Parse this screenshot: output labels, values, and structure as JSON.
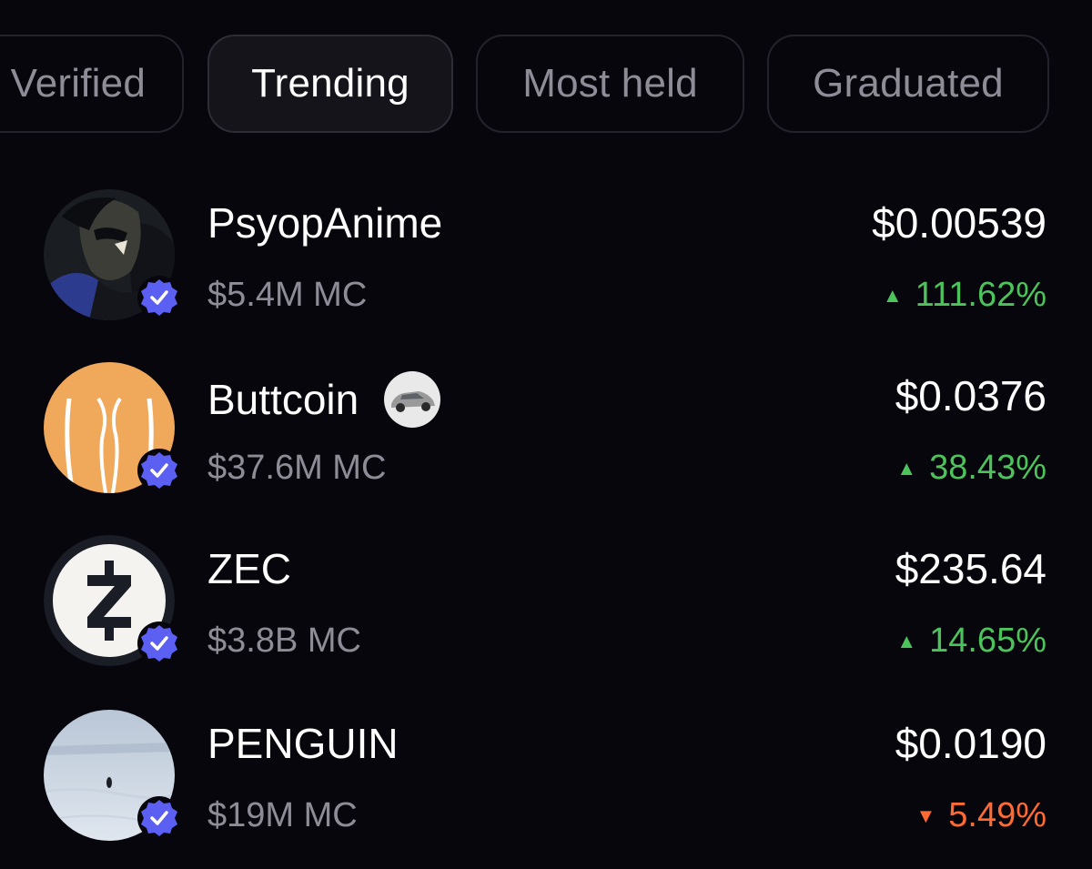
{
  "tabs": [
    {
      "label": "Verified",
      "active": false
    },
    {
      "label": "Trending",
      "active": true
    },
    {
      "label": "Most held",
      "active": false
    },
    {
      "label": "Graduated",
      "active": false
    }
  ],
  "tokens": [
    {
      "name": "PsyopAnime",
      "market_cap": "$5.4M MC",
      "price": "$0.00539",
      "change": "111.62%",
      "direction": "up",
      "verified": true
    },
    {
      "name": "Buttcoin",
      "market_cap": "$37.6M MC",
      "price": "$0.0376",
      "change": "38.43%",
      "direction": "up",
      "verified": true,
      "extra_icon": "car-icon"
    },
    {
      "name": "ZEC",
      "market_cap": "$3.8B MC",
      "price": "$235.64",
      "change": "14.65%",
      "direction": "up",
      "verified": true
    },
    {
      "name": "PENGUIN",
      "market_cap": "$19M MC",
      "price": "$0.0190",
      "change": "5.49%",
      "direction": "down",
      "verified": true
    }
  ],
  "icons": {
    "up_arrow": "▲",
    "down_arrow": "▼"
  },
  "colors": {
    "background": "#07060d",
    "positive": "#4cc35b",
    "negative": "#ff6a33",
    "verified_badge": "#5b5ff2",
    "muted_text": "#8e8c96"
  }
}
